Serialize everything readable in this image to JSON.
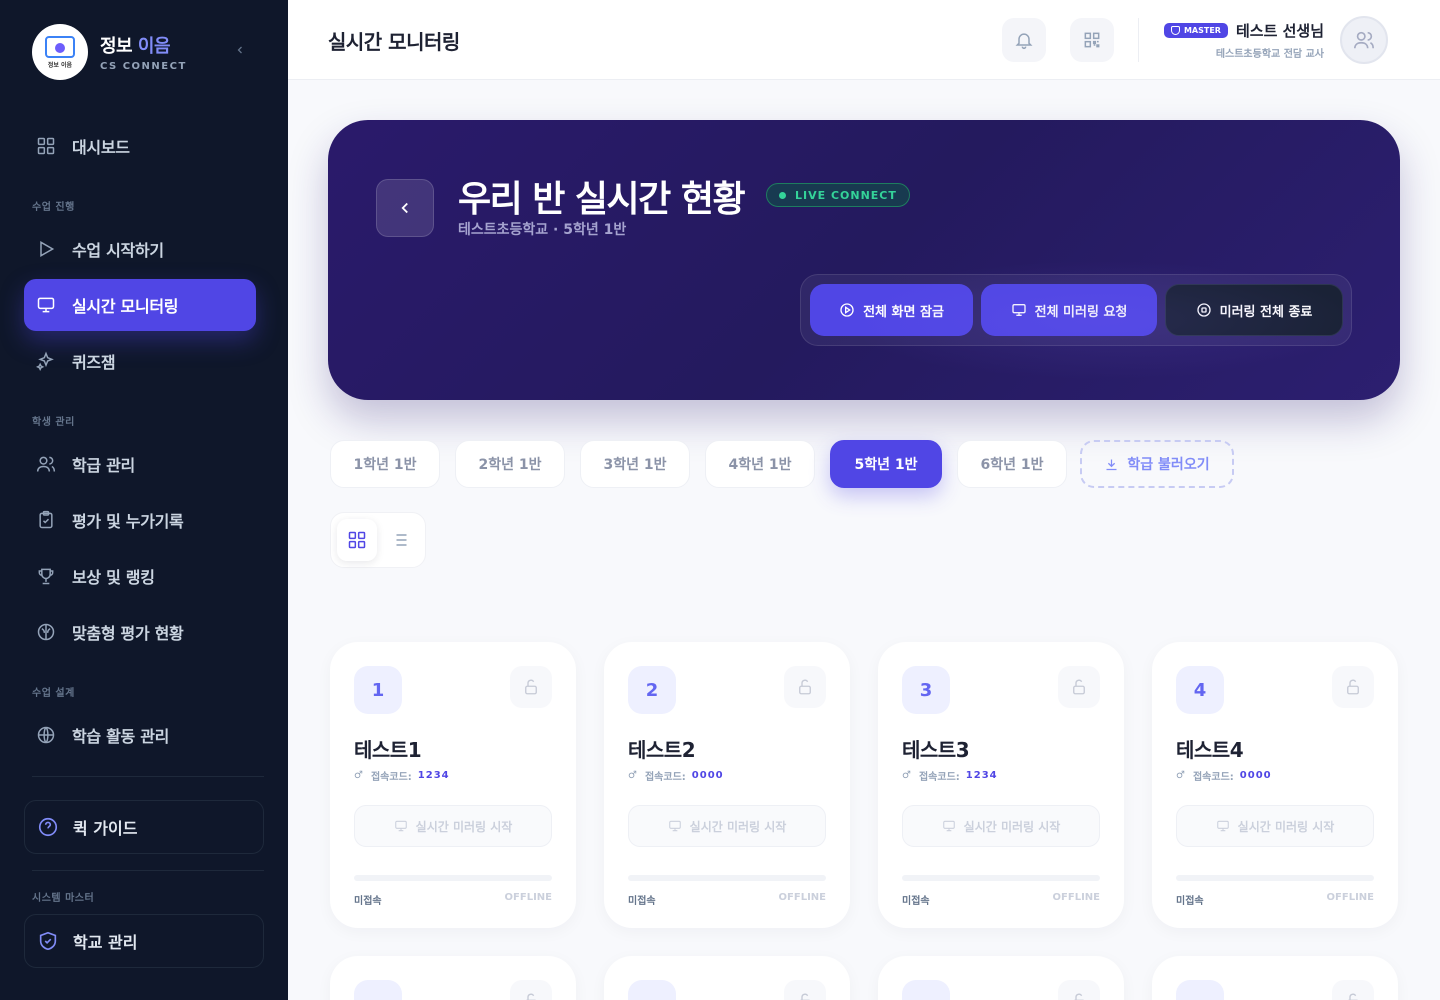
{
  "brand": {
    "title_main": "정보",
    "title_accent": "이음",
    "subtitle": "CS CONNECT",
    "logo_text": "정보 이음"
  },
  "sidebar": {
    "dashboard": "대시보드",
    "section_class": "수업 진행",
    "start_class": "수업 시작하기",
    "monitoring": "실시간 모니터링",
    "quizzam": "퀴즈잼",
    "section_students": "학생 관리",
    "class_manage": "학급 관리",
    "evaluation": "평가 및 누가기록",
    "rewards": "보상 및 랭킹",
    "custom_eval": "맞춤형 평가 현황",
    "section_design": "수업 설계",
    "activity_manage": "학습 활동 관리",
    "quick_guide": "퀵 가이드",
    "section_master": "시스템 마스터",
    "school_manage": "학교 관리"
  },
  "header": {
    "title": "실시간 모니터링",
    "badge": "MASTER",
    "user_name": "테스트 선생님",
    "user_school": "테스트초등학교 전담 교사"
  },
  "hero": {
    "title": "우리 반 실시간 현황",
    "live_badge": "LIVE CONNECT",
    "subtitle": "테스트초등학교 · 5학년 1반",
    "lock_all": "전체 화면 잠금",
    "mirror_all": "전체 미러링 요청",
    "end_mirror": "미러링 전체 종료"
  },
  "class_tabs": [
    "1학년 1반",
    "2학년 1반",
    "3학년 1반",
    "4학년 1반",
    "5학년 1반",
    "6학년 1반"
  ],
  "import_class": "학급 불러오기",
  "students": [
    {
      "num": "1",
      "name": "테스트1",
      "gender": "♂",
      "code_label": "접속코드:",
      "code": "1234",
      "mirror": "실시간 미러링 시작",
      "status": "미접속",
      "state": "OFFLINE"
    },
    {
      "num": "2",
      "name": "테스트2",
      "gender": "♂",
      "code_label": "접속코드:",
      "code": "0000",
      "mirror": "실시간 미러링 시작",
      "status": "미접속",
      "state": "OFFLINE"
    },
    {
      "num": "3",
      "name": "테스트3",
      "gender": "♂",
      "code_label": "접속코드:",
      "code": "1234",
      "mirror": "실시간 미러링 시작",
      "status": "미접속",
      "state": "OFFLINE"
    },
    {
      "num": "4",
      "name": "테스트4",
      "gender": "♂",
      "code_label": "접속코드:",
      "code": "0000",
      "mirror": "실시간 미러링 시작",
      "status": "미접속",
      "state": "OFFLINE"
    }
  ]
}
